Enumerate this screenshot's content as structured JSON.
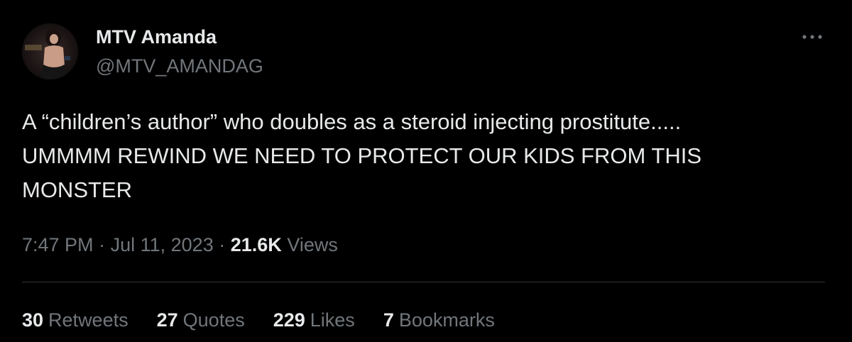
{
  "tweet": {
    "author_name": "MTV Amanda",
    "author_handle": "@MTV_AMANDAG",
    "more_icon": "more-horizontal-icon",
    "text_lines": [
      "A “children’s author” who doubles as a steroid injecting prostitute.....",
      "UMMMM REWIND WE NEED TO PROTECT OUR KIDS FROM THIS",
      "MONSTER"
    ],
    "time": "7:47 PM",
    "separator": "·",
    "date": "Jul 11, 2023",
    "views_count": "21.6K",
    "views_label": "Views"
  },
  "stats": [
    {
      "count": "30",
      "label": "Retweets"
    },
    {
      "count": "27",
      "label": "Quotes"
    },
    {
      "count": "229",
      "label": "Likes"
    },
    {
      "count": "7",
      "label": "Bookmarks"
    }
  ],
  "colors": {
    "background": "#000000",
    "primary_text": "#e7e9ea",
    "secondary_text": "#71767b",
    "divider": "#2f3336"
  }
}
